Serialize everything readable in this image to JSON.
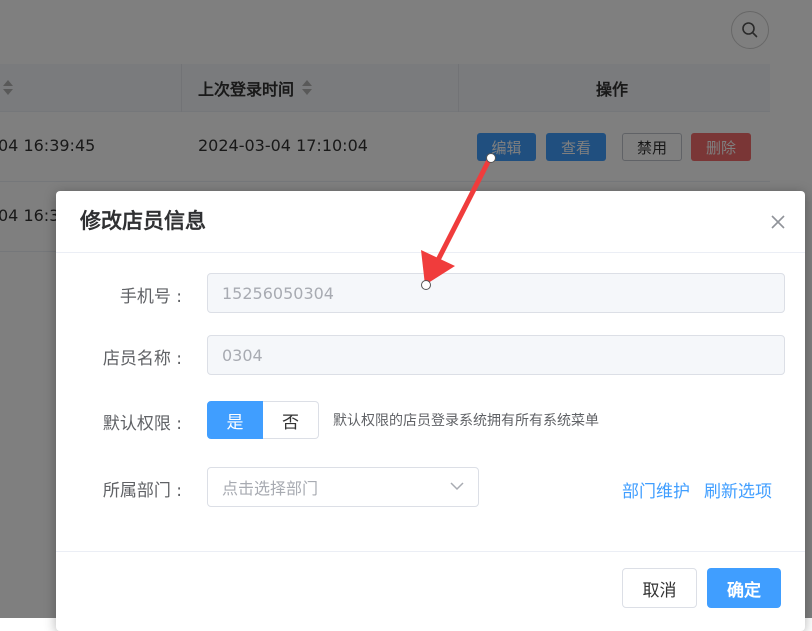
{
  "table": {
    "headers": [
      "上次登录时间",
      "操作"
    ],
    "rows": [
      {
        "col_prev": "04 16:39:45",
        "last_login": "2024-03-04 17:10:04",
        "actions": {
          "edit": "编辑",
          "view": "查看",
          "disable": "禁用",
          "delete": "删除"
        }
      },
      {
        "col_prev": "04 16:3",
        "last_login": ""
      }
    ]
  },
  "dialog": {
    "title": "修改店员信息",
    "fields": {
      "phone": {
        "label": "手机号 :",
        "value": "15256050304"
      },
      "name": {
        "label": "店员名称 :",
        "value": "0304"
      },
      "permission": {
        "label": "默认权限 :",
        "options": [
          "是",
          "否"
        ],
        "selected": "是",
        "hint": "默认权限的店员登录系统拥有所有系统菜单"
      },
      "department": {
        "label": "所属部门 :",
        "placeholder": "点击选择部门",
        "links": [
          "部门维护",
          "刷新选项"
        ]
      }
    },
    "footer": {
      "cancel": "取消",
      "confirm": "确定"
    }
  },
  "colors": {
    "primary": "#409eff",
    "danger": "#f56c6c",
    "arrow": "#f03c3c"
  },
  "icons": [
    "search-icon",
    "sort-icon",
    "close-icon",
    "chevron-down-icon"
  ]
}
